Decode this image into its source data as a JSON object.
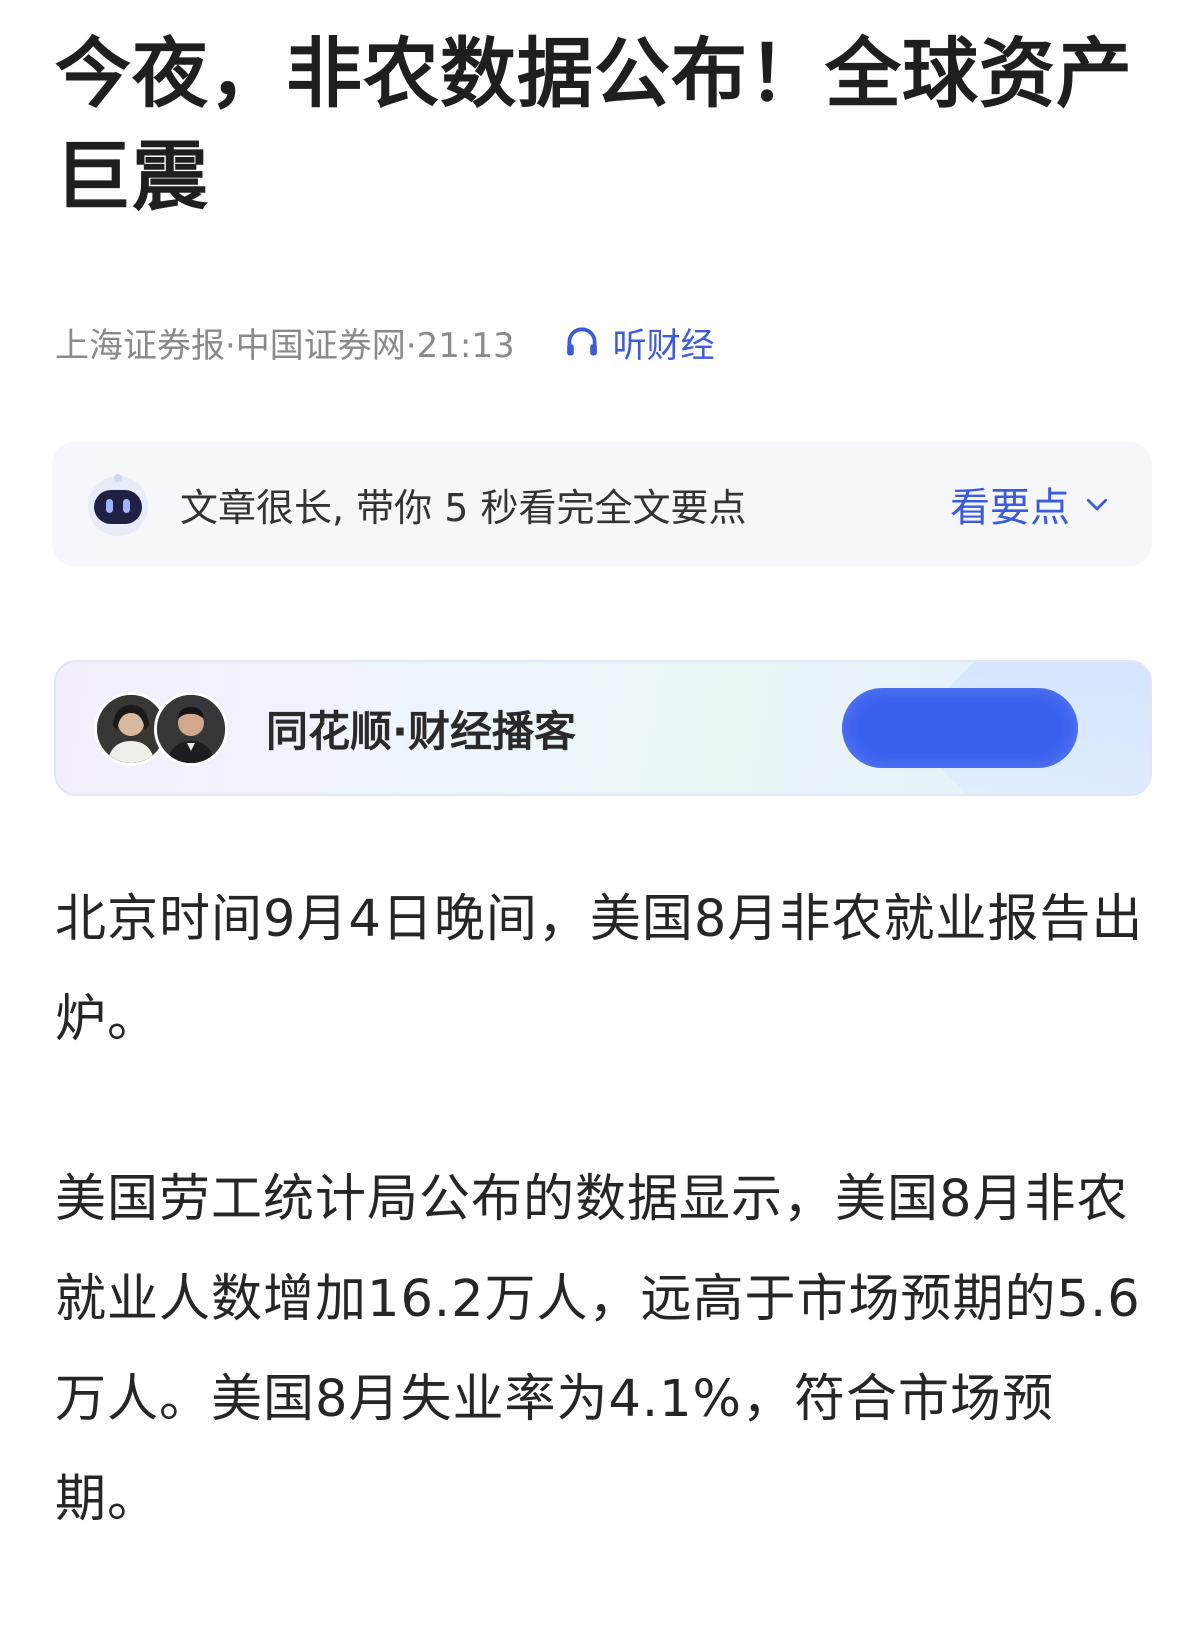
{
  "article": {
    "title": "今夜，非农数据公布！全球资产巨震",
    "meta": "上海证券报·中国证券网·21:13",
    "listen_label": "听财经"
  },
  "summary": {
    "text": "文章很长, 带你 5 秒看完全文要点",
    "action_label": "看要点"
  },
  "podcast": {
    "title": "同花顺·财经播客"
  },
  "paragraphs": [
    "北京时间9月4日晚间，美国8月非农就业报告出炉。",
    "美国劳工统计局公布的数据显示，美国8月非农就业人数增加16.2万人，远高于市场预期的5.6万人。美国8月失业率为4.1%，符合市场预期。"
  ],
  "icons": {
    "listen": "headphones-icon",
    "assistant": "robot-icon",
    "expand": "chevron-down-icon"
  },
  "colors": {
    "accent": "#3b5bdb",
    "button": "#3a61ee",
    "meta_text": "#8a8a8a"
  }
}
